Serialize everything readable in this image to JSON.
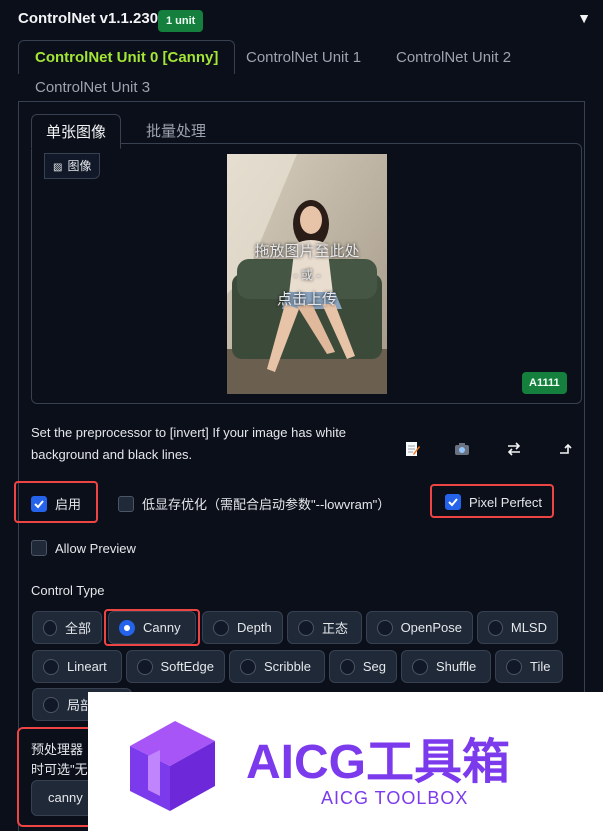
{
  "header": {
    "title": "ControlNet v1.1.230",
    "badge": "1 unit",
    "collapse_icon": "triangle-down-icon"
  },
  "unit_tabs": [
    "ControlNet Unit 0 [Canny]",
    "ControlNet Unit 1",
    "ControlNet Unit 2",
    "ControlNet Unit 3"
  ],
  "image_tabs": [
    "单张图像",
    "批量处理"
  ],
  "image_panel": {
    "label": "图像",
    "drop_text_1": "拖放图片至此处",
    "drop_text_2": "- 或 -",
    "drop_text_3": "点击上传",
    "badge": "A1111"
  },
  "hint": "Set the preprocessor to [invert] If your image has white background and black lines.",
  "options": {
    "enable": "启用",
    "lowvram": "低显存优化（需配合启动参数\"--lowvram\"）",
    "pixel_perfect": "Pixel Perfect",
    "allow_preview": "Allow Preview"
  },
  "control_type": {
    "label": "Control Type",
    "row1": [
      "全部",
      "Canny",
      "Depth",
      "正态",
      "OpenPose",
      "MLSD"
    ],
    "row2": [
      "Lineart",
      "SoftEdge",
      "Scribble",
      "Seg",
      "Shuffle",
      "Tile"
    ],
    "row3": [
      "局部"
    ],
    "selected": "Canny"
  },
  "preprocessor": {
    "label_1": "预处理器",
    "label_2": "时可选\"无",
    "value": "canny"
  },
  "watermark": {
    "title": "AICG工具箱",
    "subtitle": "AICG TOOLBOX",
    "brand_color": "#7c3aed"
  },
  "colors": {
    "accent": "#a3e635",
    "highlight": "#ef4444",
    "badge": "#15803d",
    "check": "#2563eb"
  }
}
